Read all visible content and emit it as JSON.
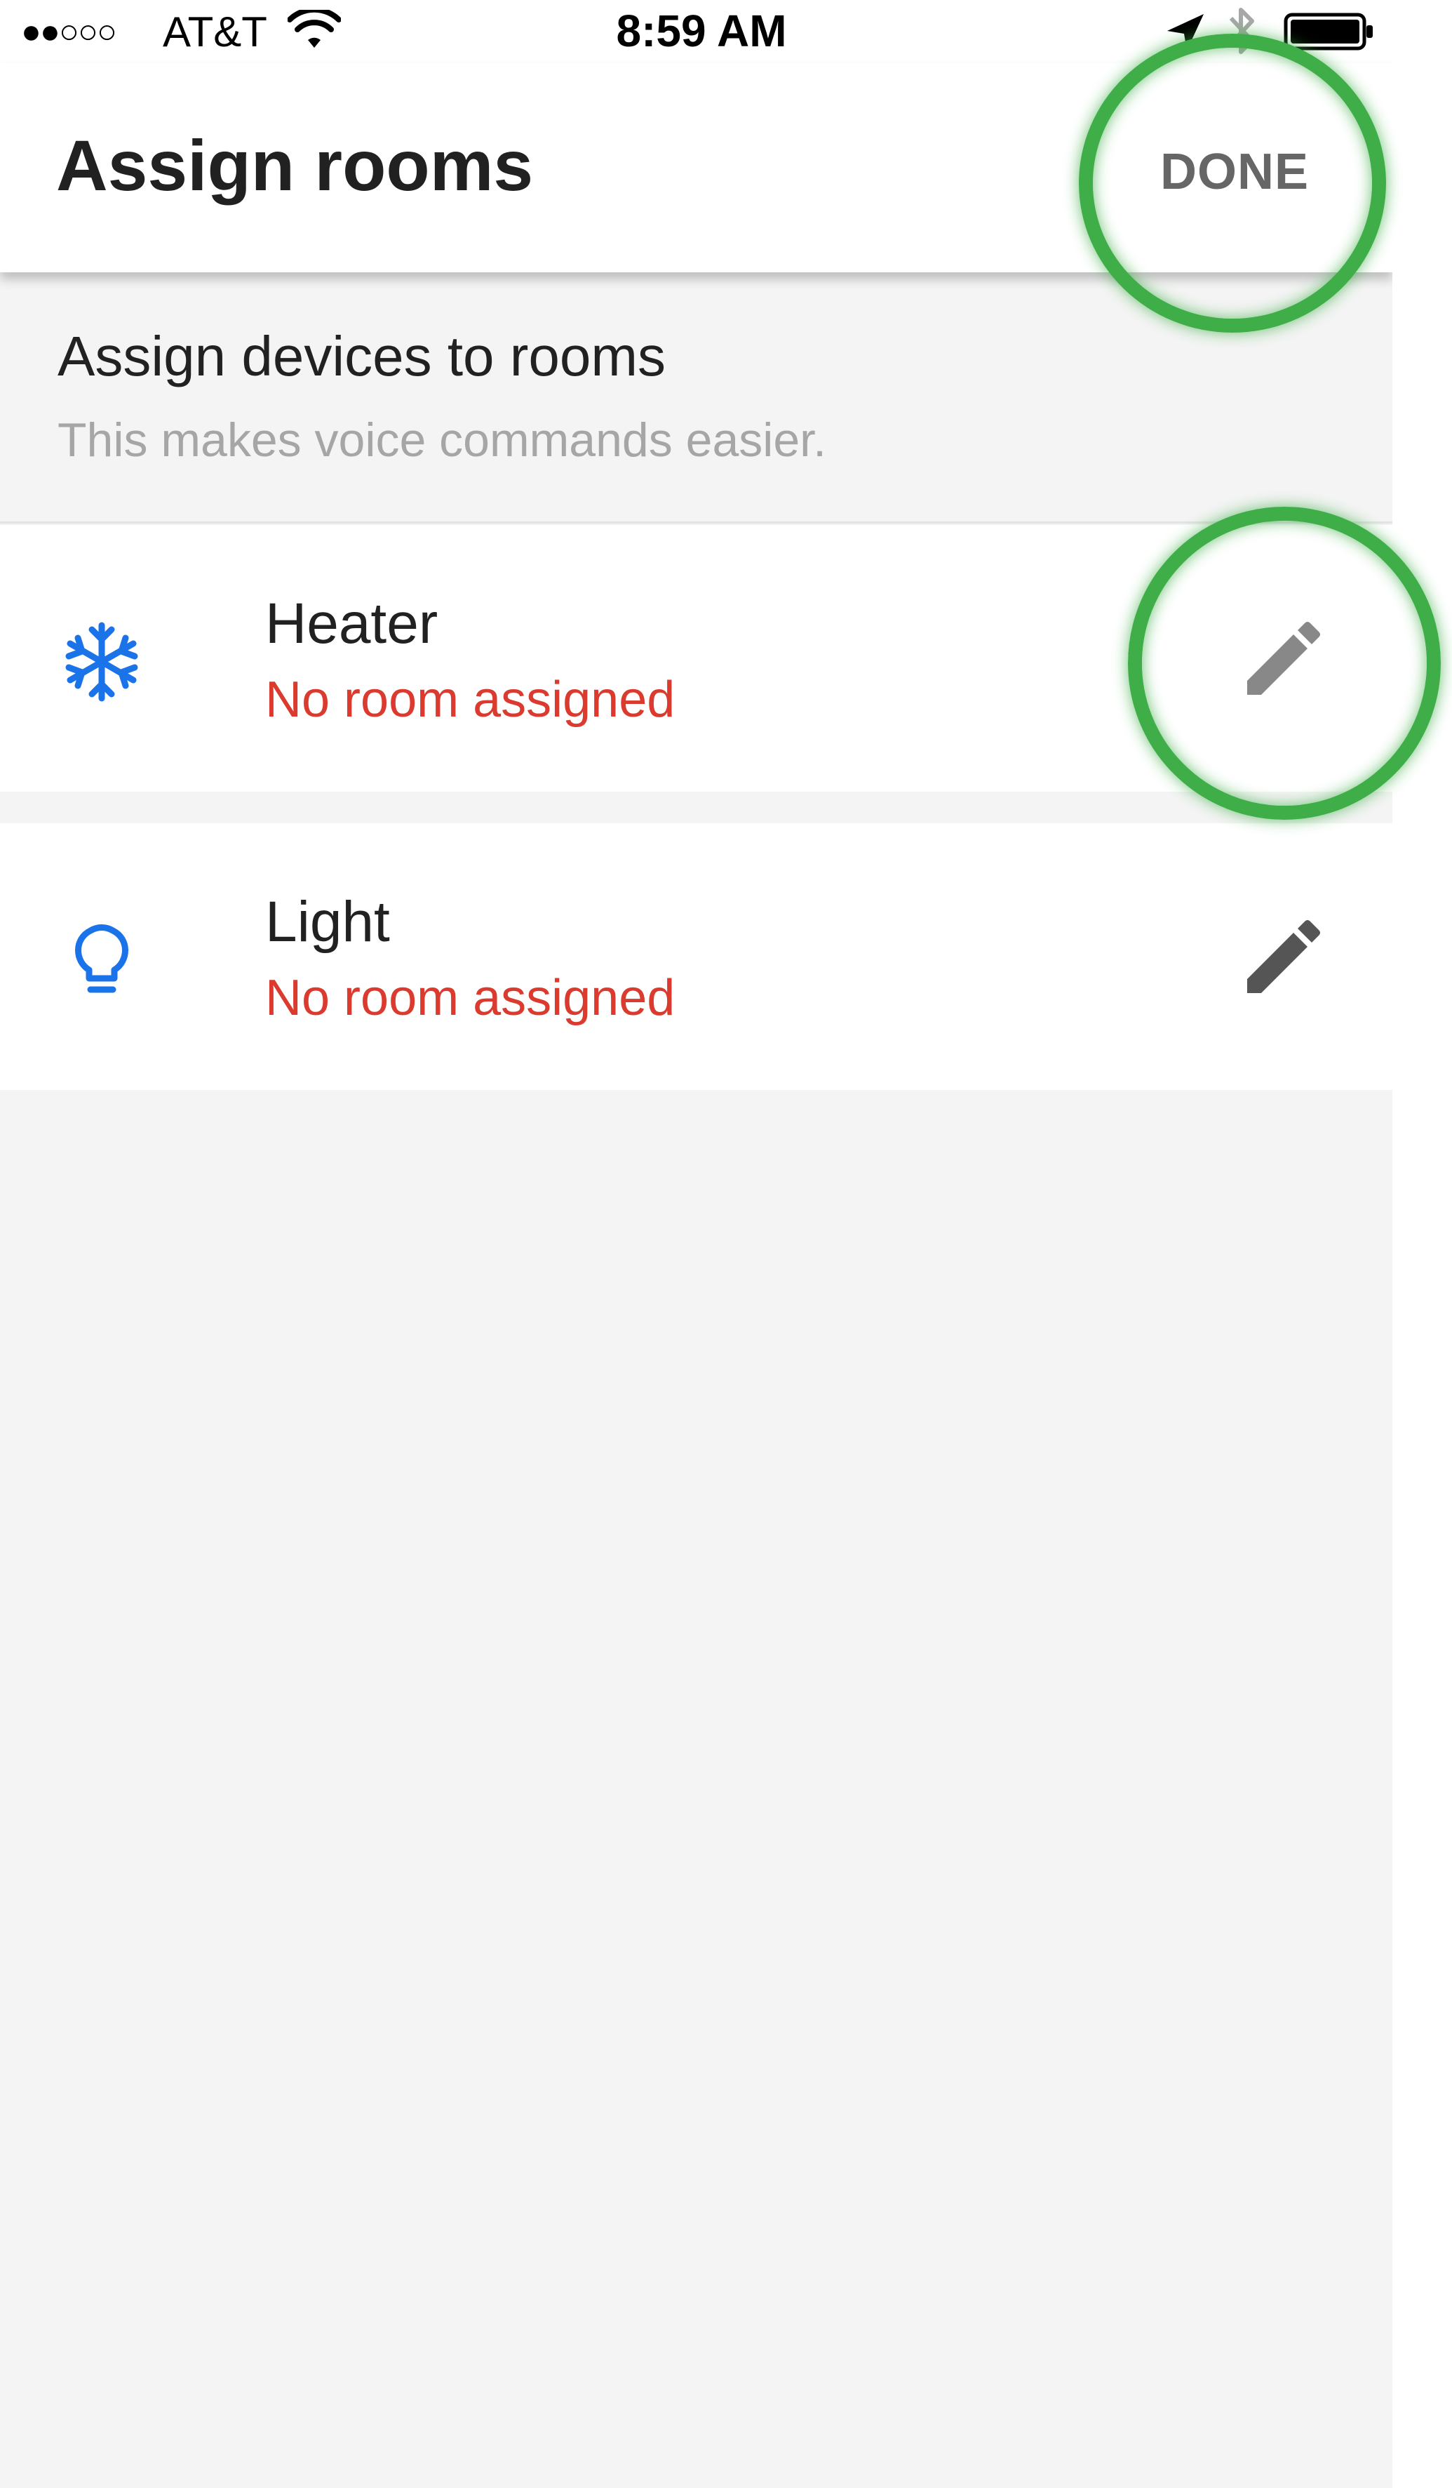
{
  "status_bar": {
    "signal": "●●○○○",
    "carrier": "AT&T",
    "time": "8:59 AM",
    "icons": [
      "wifi-icon",
      "location-arrow-icon",
      "bluetooth-icon",
      "battery-icon"
    ]
  },
  "app_bar": {
    "title": "Assign rooms",
    "done_label": "DONE"
  },
  "info": {
    "heading": "Assign devices to rooms",
    "subtext": "This makes voice commands easier."
  },
  "devices": [
    {
      "name": "Heater",
      "status": "No room assigned",
      "icon": "snowflake-icon"
    },
    {
      "name": "Light",
      "status": "No room assigned",
      "icon": "lightbulb-icon"
    }
  ],
  "colors": {
    "accent_blue": "#1a73e8",
    "status_red": "#db3b2f",
    "highlight_green": "#3fae48",
    "background": "#f4f4f4"
  }
}
